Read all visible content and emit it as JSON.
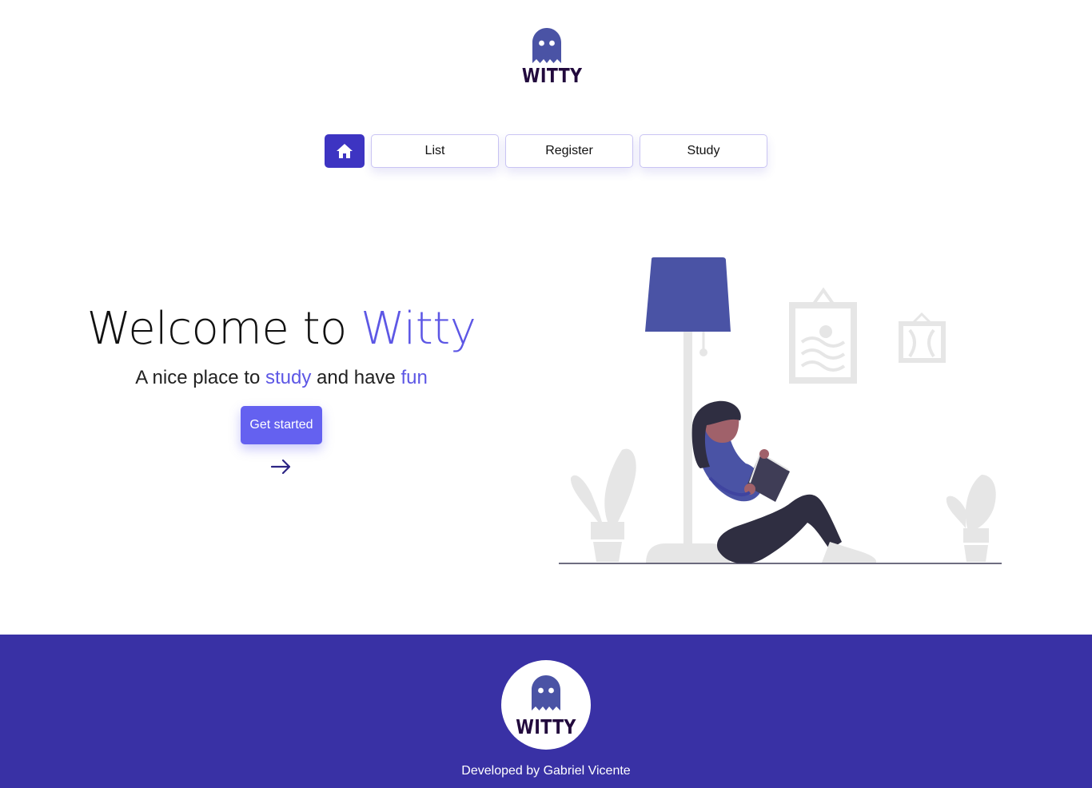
{
  "brand": {
    "name": "WITTY",
    "icon": "ghost-icon"
  },
  "nav": {
    "home_icon": "home-icon",
    "items": [
      {
        "label": "List"
      },
      {
        "label": "Register"
      },
      {
        "label": "Study"
      }
    ]
  },
  "hero": {
    "title_prefix": "Welcome to ",
    "title_accent": "Witty",
    "subtitle_part1": "A nice place to ",
    "subtitle_accent1": "study",
    "subtitle_part2": " and have ",
    "subtitle_accent2": "fun",
    "cta_label": "Get started",
    "arrow_icon": "arrow-right-icon"
  },
  "illustration": {
    "name": "reading-woman-illustration"
  },
  "footer": {
    "credit": "Developed by Gabriel Vicente",
    "brand": "WITTY"
  },
  "colors": {
    "primary": "#3d34c2",
    "accent": "#5d57e5",
    "button": "#6461f0",
    "footer_bg": "#3931a5",
    "logo_text": "#220a3d",
    "ghost": "#4a53a5"
  }
}
